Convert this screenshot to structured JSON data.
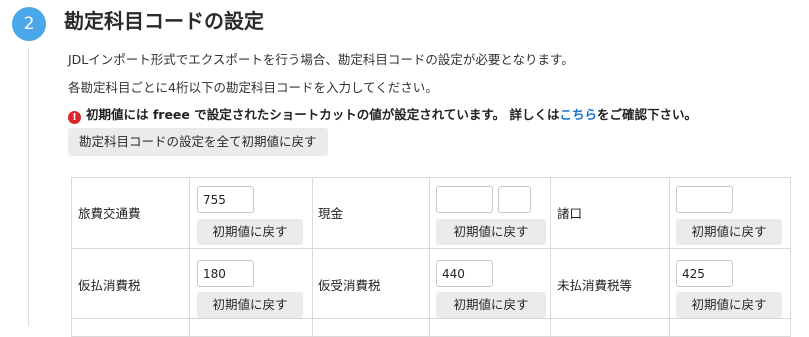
{
  "step": {
    "number": "2",
    "title": "勘定科目コードの設定"
  },
  "description": {
    "line1": "JDLインポート形式でエクスポートを行う場合、勘定科目コードの設定が必要となります。",
    "line2": "各勘定科目ごとに4桁以下の勘定科目コードを入力してください。"
  },
  "notice": {
    "icon": "exclamation-circle-icon",
    "text_before": "初期値には freee で設定されたショートカットの値が設定されています。 詳しくは",
    "link_text": "こちら",
    "text_after": "をご確認下さい。"
  },
  "reset_all_label": "勘定科目コードの設定を全て初期値に戻す",
  "accounts": [
    {
      "name": "旅費交通費",
      "code": "755",
      "reset_label": "初期値に戻す"
    },
    {
      "name": "現金",
      "code": "",
      "code2": "",
      "reset_label": "初期値に戻す"
    },
    {
      "name": "諸口",
      "code": "",
      "reset_label": "初期値に戻す"
    },
    {
      "name": "仮払消費税",
      "code": "180",
      "reset_label": "初期値に戻す"
    },
    {
      "name": "仮受消費税",
      "code": "440",
      "reset_label": "初期値に戻す"
    },
    {
      "name": "未払消費税等",
      "code": "425",
      "reset_label": "初期値に戻す"
    }
  ],
  "colors": {
    "accent": "#4aa8ea",
    "link": "#1976c9",
    "warning": "#d9262c"
  }
}
